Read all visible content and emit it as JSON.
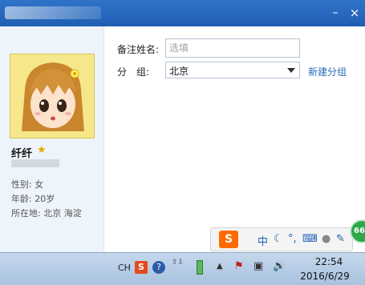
{
  "window": {
    "minimize_label": "–",
    "close_label": "×"
  },
  "profile": {
    "nickname": "纤纤",
    "star_icon": "★",
    "gender": "性别: 女",
    "age": "年龄: 20岁",
    "location": "所在地: 北京 海淀"
  },
  "form": {
    "remark_label": "备注姓名:",
    "remark_placeholder": "选填",
    "group_label": "分　组:",
    "group_value": "北京",
    "new_group_link": "新建分组"
  },
  "ime_bar": {
    "logo": "S",
    "chinese": "中",
    "moon": "☾",
    "punct": "°,",
    "keyboard": "⌨",
    "user": "●",
    "tools": "✎"
  },
  "badge": {
    "text": "66"
  },
  "taskbar": {
    "lang": "CH",
    "ime_logo": "S",
    "help": "?",
    "arrows": "⇧⇩",
    "show_hidden": "▲",
    "flag": "⚑",
    "network": "▣",
    "volume": "🔊",
    "time": "22:54",
    "date": "2016/6/29"
  }
}
